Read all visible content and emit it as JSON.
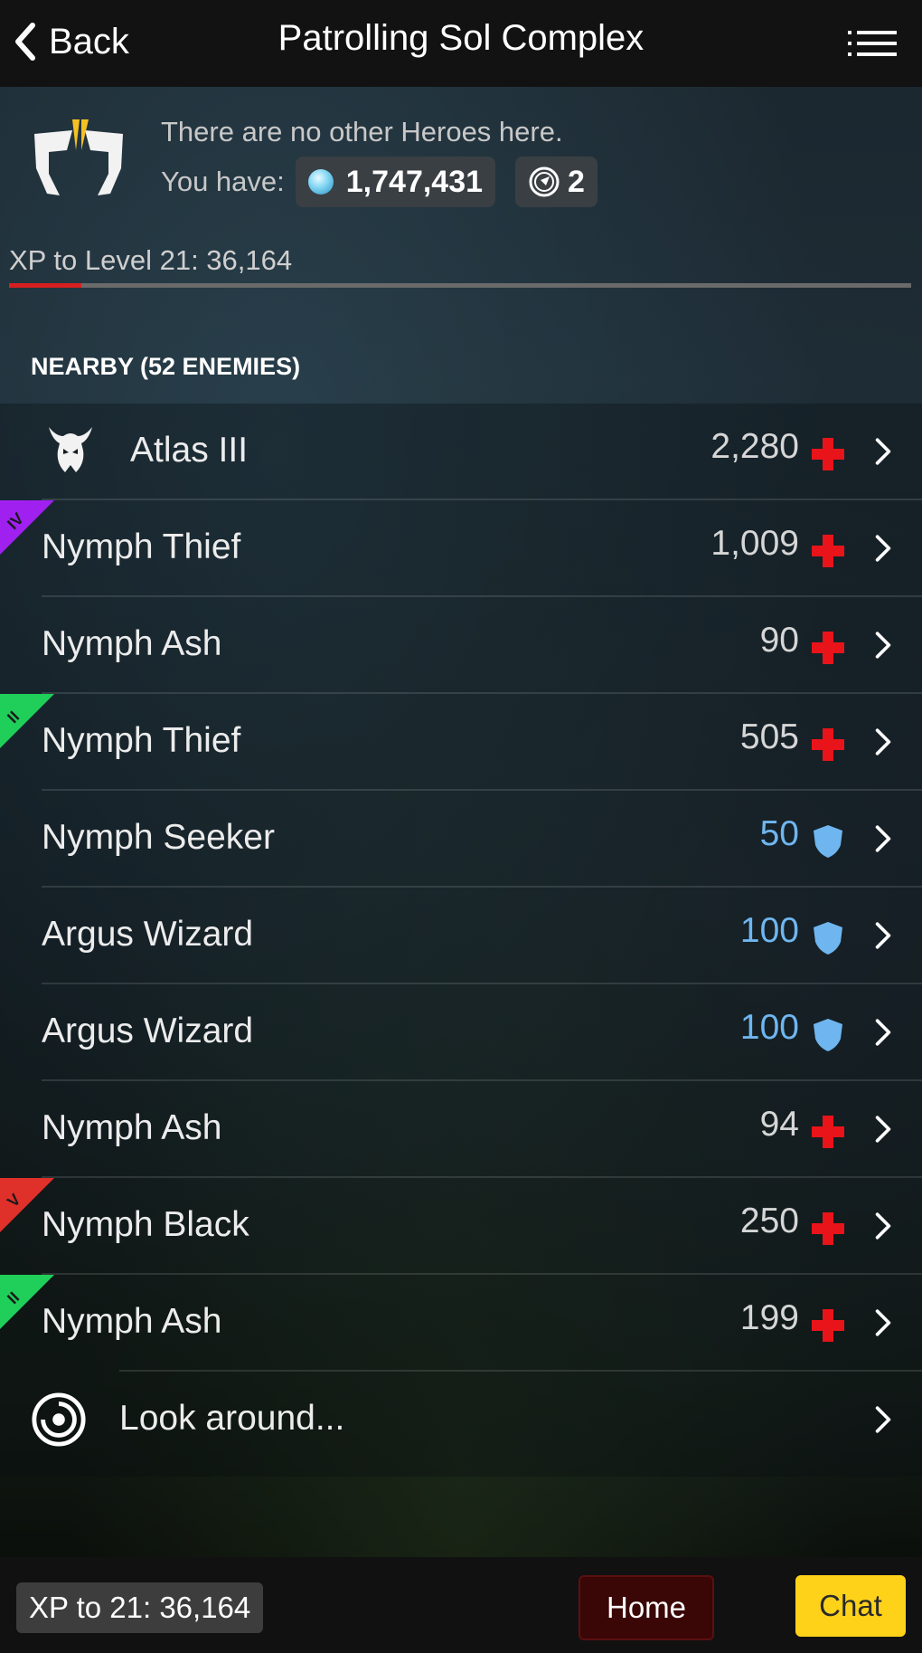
{
  "topbar": {
    "back_label": "Back",
    "title": "Patrolling Sol Complex",
    "menu_icon": "list-menu-icon"
  },
  "hero": {
    "note": "There are no other Heroes here.",
    "have_label": "You have:",
    "credits": "1,747,431",
    "tokens": "2",
    "xp_label": "XP to Level 21: 36,164",
    "xp_progress": 0.08,
    "xp_bar_color": "#d62020"
  },
  "nearby": {
    "title": "NEARBY (52 ENEMIES)",
    "items": [
      {
        "name": "Atlas III",
        "value": "2,280",
        "stat": "health",
        "tier": "",
        "tier_color": "",
        "icon": "demon-helmet-icon"
      },
      {
        "name": "Nymph Thief",
        "value": "1,009",
        "stat": "health",
        "tier": "IV",
        "tier_color": "#a020f0"
      },
      {
        "name": "Nymph Ash",
        "value": "90",
        "stat": "health",
        "tier": "",
        "tier_color": ""
      },
      {
        "name": "Nymph Thief",
        "value": "505",
        "stat": "health",
        "tier": "II",
        "tier_color": "#1fcf5a"
      },
      {
        "name": "Nymph Seeker",
        "value": "50",
        "stat": "shield",
        "tier": "",
        "tier_color": ""
      },
      {
        "name": "Argus Wizard",
        "value": "100",
        "stat": "shield",
        "tier": "",
        "tier_color": ""
      },
      {
        "name": "Argus Wizard",
        "value": "100",
        "stat": "shield",
        "tier": "",
        "tier_color": ""
      },
      {
        "name": "Nymph Ash",
        "value": "94",
        "stat": "health",
        "tier": "",
        "tier_color": ""
      },
      {
        "name": "Nymph Black",
        "value": "250",
        "stat": "health",
        "tier": "V",
        "tier_color": "#e0302a"
      },
      {
        "name": "Nymph Ash",
        "value": "199",
        "stat": "health",
        "tier": "II",
        "tier_color": "#1fcf5a"
      }
    ],
    "look_around": "Look around..."
  },
  "colors": {
    "health": "#e8141a",
    "shield": "#6fb6f0",
    "home_bg": "#3a0606",
    "chat_bg": "#ffd21a"
  },
  "bottombar": {
    "xp_chip": "XP to 21: 36,164",
    "home_label": "Home",
    "chat_label": "Chat"
  }
}
